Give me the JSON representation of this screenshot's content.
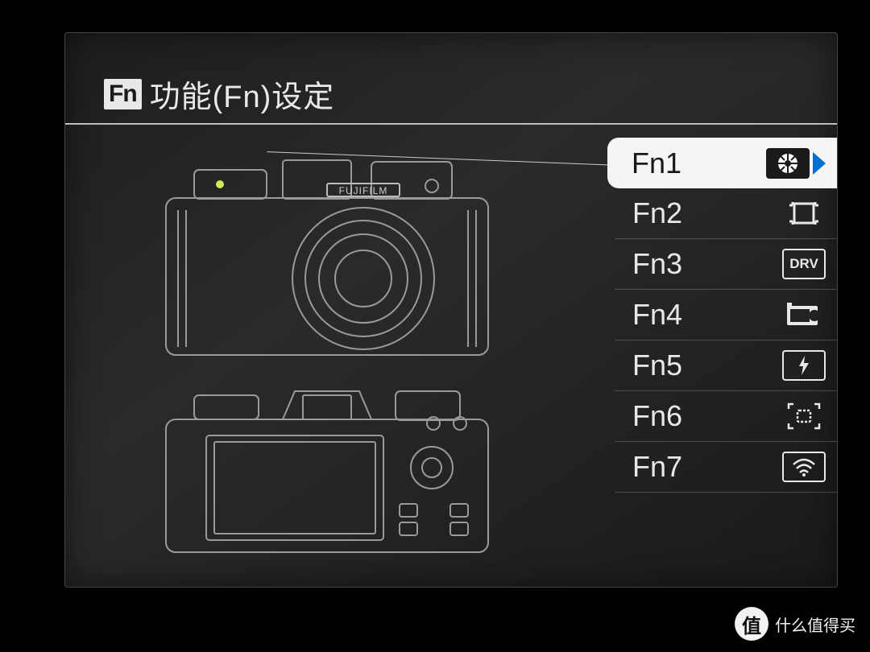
{
  "header": {
    "badge": "Fn",
    "title": "功能(Fn)设定"
  },
  "illustration": {
    "brand": "FUJIFILM"
  },
  "fn_items": [
    {
      "label": "Fn1",
      "icon": "aperture",
      "selected": true
    },
    {
      "label": "Fn2",
      "icon": "af-area",
      "selected": false
    },
    {
      "label": "Fn3",
      "icon": "drv",
      "selected": false
    },
    {
      "label": "Fn4",
      "icon": "film",
      "selected": false
    },
    {
      "label": "Fn5",
      "icon": "flash",
      "selected": false
    },
    {
      "label": "Fn6",
      "icon": "focus-peak",
      "selected": false
    },
    {
      "label": "Fn7",
      "icon": "wifi",
      "selected": false
    }
  ],
  "icon_text": {
    "drv": "DRV"
  },
  "watermark": {
    "logo": "值",
    "text": "什么值得买"
  }
}
